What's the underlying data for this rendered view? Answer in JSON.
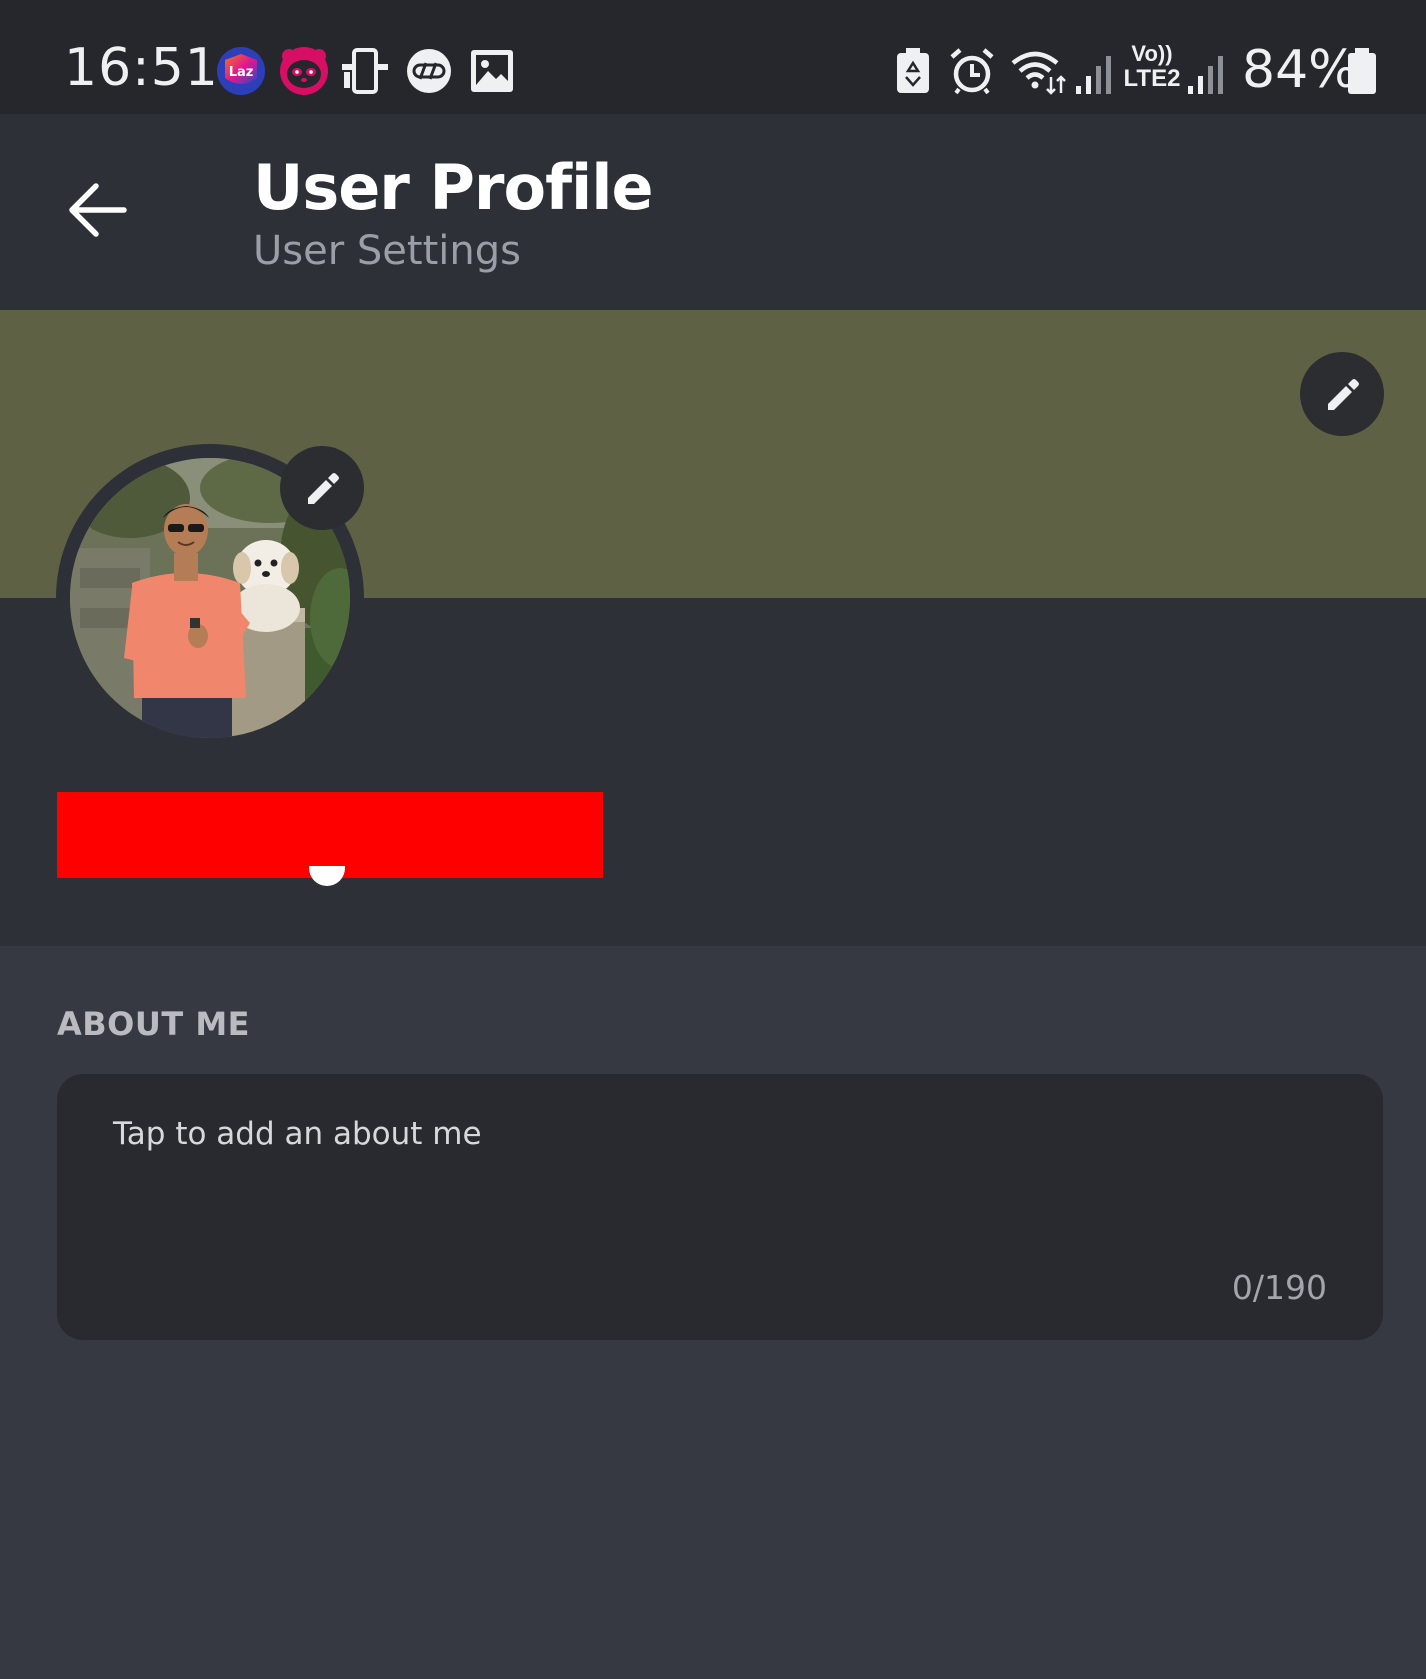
{
  "status_bar": {
    "time": "16:51",
    "battery_percent_text": "84%",
    "network_label_top": "Vo))",
    "network_label_bottom": "LTE2",
    "laz_badge_text": "Laz",
    "left_icons": [
      "lazada-app-icon",
      "foodpanda-app-icon",
      "phone-sync-icon",
      "voicemail-icon",
      "gallery-icon"
    ],
    "right_icons": [
      "device-care-icon",
      "alarm-icon",
      "wifi-icon",
      "signal-1-icon",
      "volte-icon",
      "signal-2-icon",
      "battery-icon"
    ]
  },
  "header": {
    "title": "User Profile",
    "subtitle": "User Settings",
    "back_icon": "back-arrow-icon"
  },
  "profile": {
    "banner_color": "#5f6145",
    "edit_icon": "pencil-icon",
    "avatar_description_icon": "avatar-photo"
  },
  "about": {
    "label": "ABOUT ME",
    "placeholder": "Tap to add an about me",
    "counter": "0/190"
  },
  "colors": {
    "status_bar_bg": "#25272d",
    "header_bg": "#2e3037",
    "page_bg": "#363942",
    "input_bg": "#292a30",
    "redaction": "#ff0000"
  }
}
